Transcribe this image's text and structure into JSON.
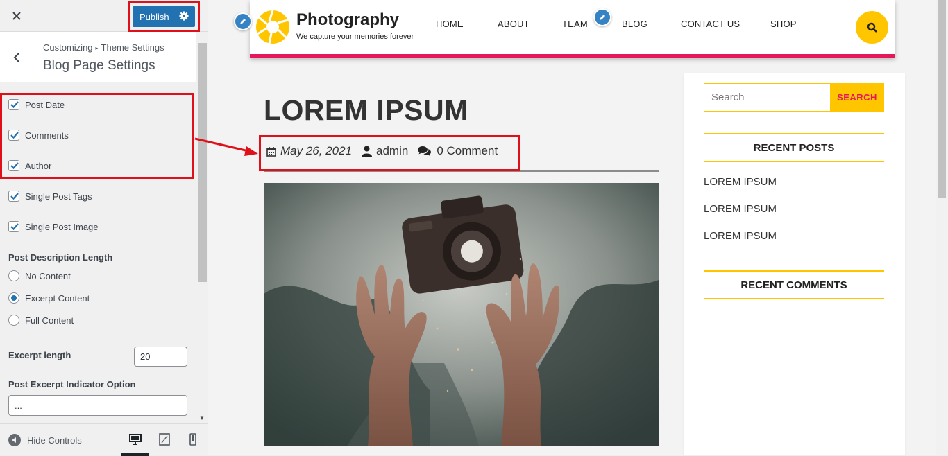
{
  "customizer": {
    "close_label": "×",
    "publish_label": "Publish",
    "breadcrumb": {
      "root": "Customizing",
      "section": "Theme Settings"
    },
    "panel_title": "Blog Page Settings",
    "checkboxes": [
      {
        "label": "Post Date",
        "checked": true
      },
      {
        "label": "Comments",
        "checked": true
      },
      {
        "label": "Author",
        "checked": true
      },
      {
        "label": "Single Post Tags",
        "checked": true
      },
      {
        "label": "Single Post Image",
        "checked": true
      }
    ],
    "description_length": {
      "label": "Post Description Length",
      "options": [
        "No Content",
        "Excerpt Content",
        "Full Content"
      ],
      "selected": "Excerpt Content"
    },
    "excerpt_length": {
      "label": "Excerpt length",
      "value": "20"
    },
    "excerpt_indicator": {
      "label": "Post Excerpt Indicator Option",
      "value": "..."
    },
    "footer": {
      "hide_controls": "Hide Controls"
    }
  },
  "site": {
    "name": "Photography",
    "tagline": "We capture your memories forever",
    "accent": "#e5185c",
    "yellow": "#ffc600",
    "nav": [
      "HOME",
      "ABOUT",
      "TEAM",
      "BLOG",
      "CONTACT US",
      "SHOP"
    ]
  },
  "post": {
    "title": "LOREM IPSUM",
    "date": "May 26, 2021",
    "author": "admin",
    "comments": "0 Comment"
  },
  "widgets": {
    "search_placeholder": "Search",
    "search_button": "SEARCH",
    "recent_posts_title": "RECENT POSTS",
    "recent_posts": [
      "LOREM IPSUM",
      "LOREM IPSUM",
      "LOREM IPSUM"
    ],
    "recent_comments_title": "RECENT COMMENTS"
  }
}
